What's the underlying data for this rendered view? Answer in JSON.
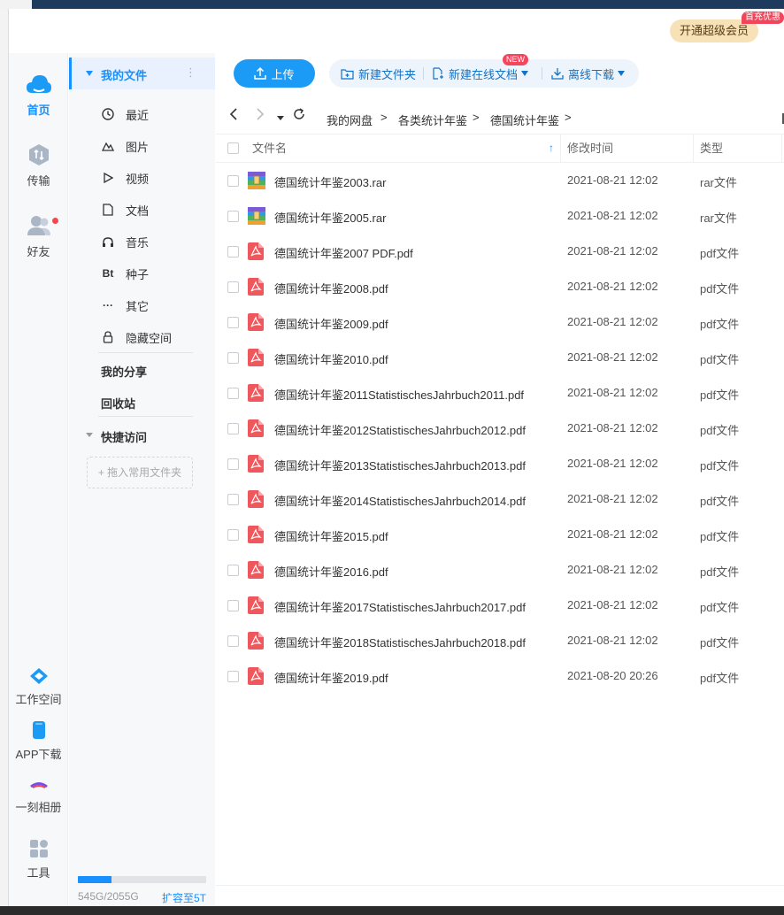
{
  "titlebar": {
    "vip_label": "开通超级会员",
    "vip_badge": "首充优惠"
  },
  "rail": {
    "home": "首页",
    "transfer": "传输",
    "friends": "好友",
    "workspace": "工作空间",
    "app_download": "APP下载",
    "album": "一刻相册",
    "tools": "工具"
  },
  "nav": {
    "my_files": "我的文件",
    "more": "⋮",
    "items": [
      {
        "label": "最近",
        "icon": "clock-icon"
      },
      {
        "label": "图片",
        "icon": "image-icon"
      },
      {
        "label": "视频",
        "icon": "play-icon"
      },
      {
        "label": "文档",
        "icon": "doc-icon"
      },
      {
        "label": "音乐",
        "icon": "headphones-icon"
      },
      {
        "label": "种子",
        "icon": "bt-icon",
        "glyph": "Bt"
      },
      {
        "label": "其它",
        "icon": "dots-icon",
        "glyph": "···"
      },
      {
        "label": "隐藏空间",
        "icon": "lock-icon"
      }
    ],
    "my_share": "我的分享",
    "recycle_bin": "回收站",
    "quick_access": "快捷访问",
    "drop_hint": "+ 拖入常用文件夹",
    "quota_text": "545G/2055G",
    "quota_expand": "扩容至5T",
    "quota_fraction": 0.265
  },
  "toolbar": {
    "upload": "上传",
    "new_folder": "新建文件夹",
    "new_online_doc": "新建在线文档",
    "new_badge": "NEW",
    "offline_download": "离线下载"
  },
  "path": {
    "crumbs": [
      "我的网盘",
      "各类统计年鉴",
      "德国统计年鉴"
    ],
    "sep": ">"
  },
  "table": {
    "col_name": "文件名",
    "col_time": "修改时间",
    "col_type": "类型",
    "sort_indicator": "↑",
    "rows": [
      {
        "name": "德国统计年鉴2003.rar",
        "time": "2021-08-21 12:02",
        "type": "rar文件",
        "icon": "rar-icon"
      },
      {
        "name": "德国统计年鉴2005.rar",
        "time": "2021-08-21 12:02",
        "type": "rar文件",
        "icon": "rar-icon"
      },
      {
        "name": "德国统计年鉴2007   PDF.pdf",
        "time": "2021-08-21 12:02",
        "type": "pdf文件",
        "icon": "pdf-icon"
      },
      {
        "name": "德国统计年鉴2008.pdf",
        "time": "2021-08-21 12:02",
        "type": "pdf文件",
        "icon": "pdf-icon"
      },
      {
        "name": "德国统计年鉴2009.pdf",
        "time": "2021-08-21 12:02",
        "type": "pdf文件",
        "icon": "pdf-icon"
      },
      {
        "name": "德国统计年鉴2010.pdf",
        "time": "2021-08-21 12:02",
        "type": "pdf文件",
        "icon": "pdf-icon"
      },
      {
        "name": "德国统计年鉴2011StatistischesJahrbuch2011.pdf",
        "time": "2021-08-21 12:02",
        "type": "pdf文件",
        "icon": "pdf-icon"
      },
      {
        "name": "德国统计年鉴2012StatistischesJahrbuch2012.pdf",
        "time": "2021-08-21 12:02",
        "type": "pdf文件",
        "icon": "pdf-icon"
      },
      {
        "name": "德国统计年鉴2013StatistischesJahrbuch2013.pdf",
        "time": "2021-08-21 12:02",
        "type": "pdf文件",
        "icon": "pdf-icon"
      },
      {
        "name": "德国统计年鉴2014StatistischesJahrbuch2014.pdf",
        "time": "2021-08-21 12:02",
        "type": "pdf文件",
        "icon": "pdf-icon"
      },
      {
        "name": "德国统计年鉴2015.pdf",
        "time": "2021-08-21 12:02",
        "type": "pdf文件",
        "icon": "pdf-icon"
      },
      {
        "name": "德国统计年鉴2016.pdf",
        "time": "2021-08-21 12:02",
        "type": "pdf文件",
        "icon": "pdf-icon"
      },
      {
        "name": "德国统计年鉴2017StatistischesJahrbuch2017.pdf",
        "time": "2021-08-21 12:02",
        "type": "pdf文件",
        "icon": "pdf-icon"
      },
      {
        "name": "德国统计年鉴2018StatistischesJahrbuch2018.pdf",
        "time": "2021-08-21 12:02",
        "type": "pdf文件",
        "icon": "pdf-icon"
      },
      {
        "name": "德国统计年鉴2019.pdf",
        "time": "2021-08-20 20:26",
        "type": "pdf文件",
        "icon": "pdf-icon"
      }
    ]
  },
  "colors": {
    "accent": "#1890ff",
    "pdf": "#f0575d",
    "vip_bg": "#f7e2b8"
  }
}
